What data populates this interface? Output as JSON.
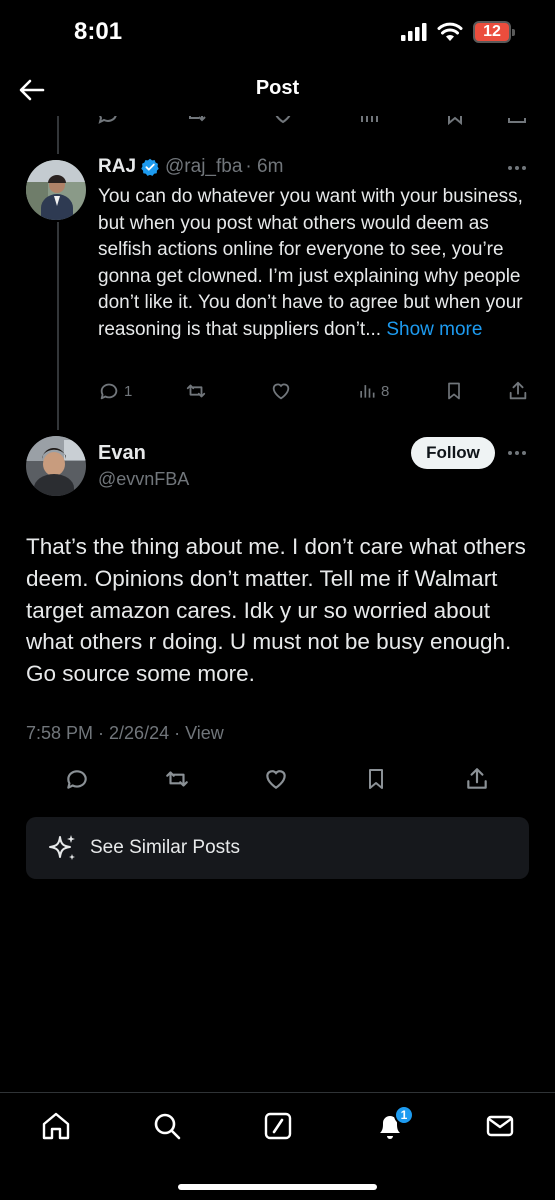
{
  "status_bar": {
    "time": "8:01",
    "battery": "12"
  },
  "header": {
    "title": "Post"
  },
  "reply": {
    "name": "RAJ",
    "handle": "@raj_fba",
    "time": "· 6m",
    "text": "You can do whatever you want with your business, but when you post what others would deem as selfish actions online for everyone to see, you’re gonna get clowned. I’m just explaining why people don’t like it. You don’t have to agree but when your reasoning is that suppliers don’t...",
    "show_more": "Show more",
    "reply_count": "1",
    "view_count": "8"
  },
  "post": {
    "author_name": "Evan",
    "author_handle": "@evvnFBA",
    "follow_label": "Follow",
    "text": "That’s the thing about me. I don’t care what others deem. Opinions don’t matter. Tell me if Walmart target amazon cares. Idk y ur so worried about what others r doing. U must not be busy enough. Go source some more.",
    "meta": "7:58 PM · 2/26/24 · View"
  },
  "similar": {
    "label": "See Similar Posts"
  },
  "tabs": {
    "notifications_badge": "1"
  },
  "colors": {
    "accent": "#1d9bf0",
    "background": "#000000",
    "muted": "#71767b",
    "battery": "#eb4d3d"
  },
  "icons": [
    "back-arrow-icon",
    "verified-badge-icon",
    "reply-icon",
    "retweet-icon",
    "like-icon",
    "views-icon",
    "bookmark-icon",
    "share-icon",
    "sparkle-icon",
    "home-icon",
    "search-icon",
    "grok-icon",
    "bell-icon",
    "mail-icon"
  ]
}
